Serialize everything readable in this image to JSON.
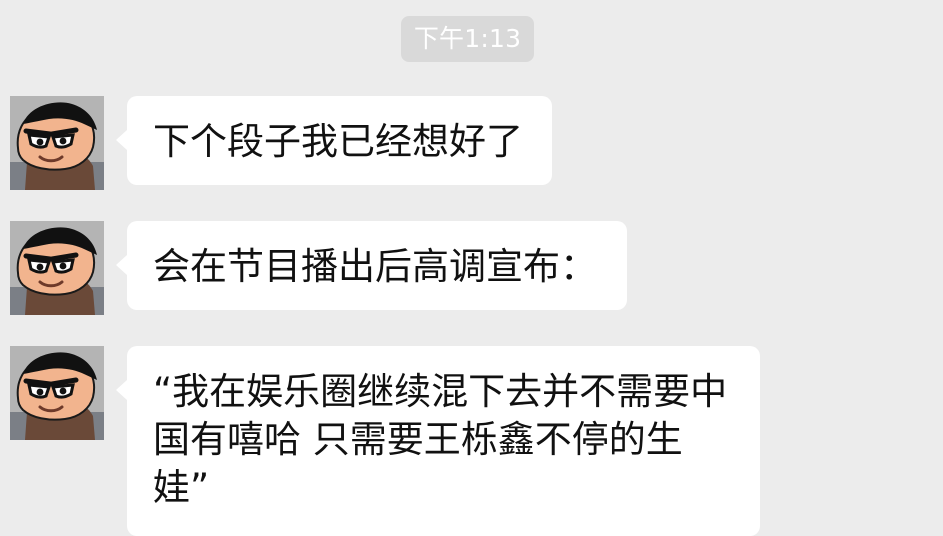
{
  "chat": {
    "timestamp": "下午1:13",
    "messages": [
      {
        "avatar_icon": "cartoon-avatar-icon",
        "text": "下个段子我已经想好了"
      },
      {
        "avatar_icon": "cartoon-avatar-icon",
        "text": "会在节目播出后高调宣布："
      },
      {
        "avatar_icon": "cartoon-avatar-icon",
        "text": "“我在娱乐圈继续混下去并不需要中国有嘻哈 只需要王栎鑫不停的生娃”"
      }
    ]
  },
  "colors": {
    "background": "#ececec",
    "bubble": "#ffffff",
    "timestamp_badge": "#d9d9d9"
  }
}
